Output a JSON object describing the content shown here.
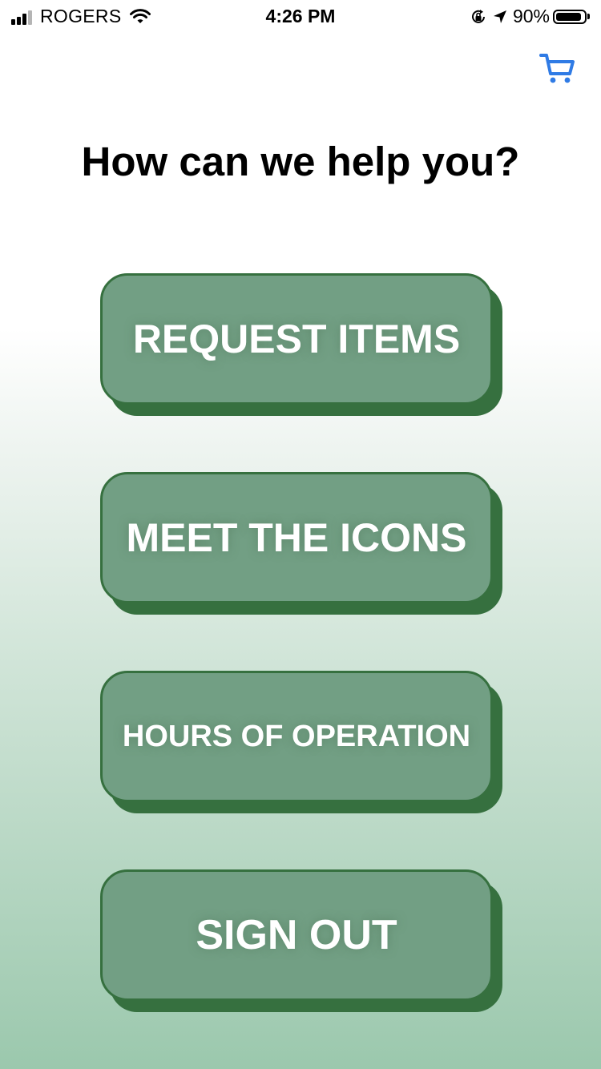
{
  "status_bar": {
    "carrier": "ROGERS",
    "time": "4:26 PM",
    "battery_percent": "90%",
    "battery_level": 0.9,
    "icons": [
      "signal-icon",
      "wifi-icon",
      "orientation-lock-icon",
      "location-arrow-icon",
      "battery-icon"
    ]
  },
  "header": {
    "cart_icon": "cart-icon",
    "cart_color": "#2f7be5"
  },
  "title": "How can we help you?",
  "menu": [
    {
      "label": "REQUEST ITEMS"
    },
    {
      "label": "MEET THE ICONS"
    },
    {
      "label": "HOURS OF OPERATION"
    },
    {
      "label": "SIGN OUT"
    }
  ],
  "colors": {
    "button_fill": "#729f84",
    "button_border": "#36703f",
    "gradient_bottom": "#9bc8ad"
  }
}
